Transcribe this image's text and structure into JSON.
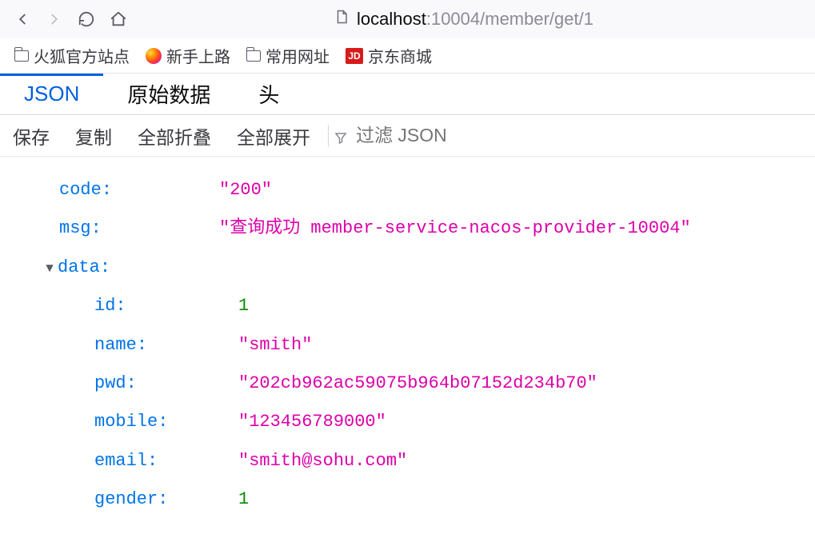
{
  "url": {
    "host": "localhost",
    "rest": ":10004/member/get/1"
  },
  "bookmarks": {
    "item1": "火狐官方站点",
    "item2": "新手上路",
    "item3": "常用网址",
    "item4": "京东商城",
    "jd": "JD"
  },
  "tabs": {
    "json": "JSON",
    "raw": "原始数据",
    "headers": "头"
  },
  "tools": {
    "save": "保存",
    "copy": "复制",
    "collapseAll": "全部折叠",
    "expandAll": "全部展开",
    "filterPlaceholder": "过滤 JSON"
  },
  "json": {
    "code": {
      "key": "code",
      "value": "\"200\""
    },
    "msg": {
      "key": "msg",
      "value": "\"查询成功 member-service-nacos-provider-10004\""
    },
    "data": {
      "key": "data",
      "id": {
        "key": "id",
        "value": "1"
      },
      "name": {
        "key": "name",
        "value": "\"smith\""
      },
      "pwd": {
        "key": "pwd",
        "value": "\"202cb962ac59075b964b07152d234b70\""
      },
      "mobile": {
        "key": "mobile",
        "value": "\"123456789000\""
      },
      "email": {
        "key": "email",
        "value": "\"smith@sohu.com\""
      },
      "gender": {
        "key": "gender",
        "value": "1"
      }
    }
  }
}
